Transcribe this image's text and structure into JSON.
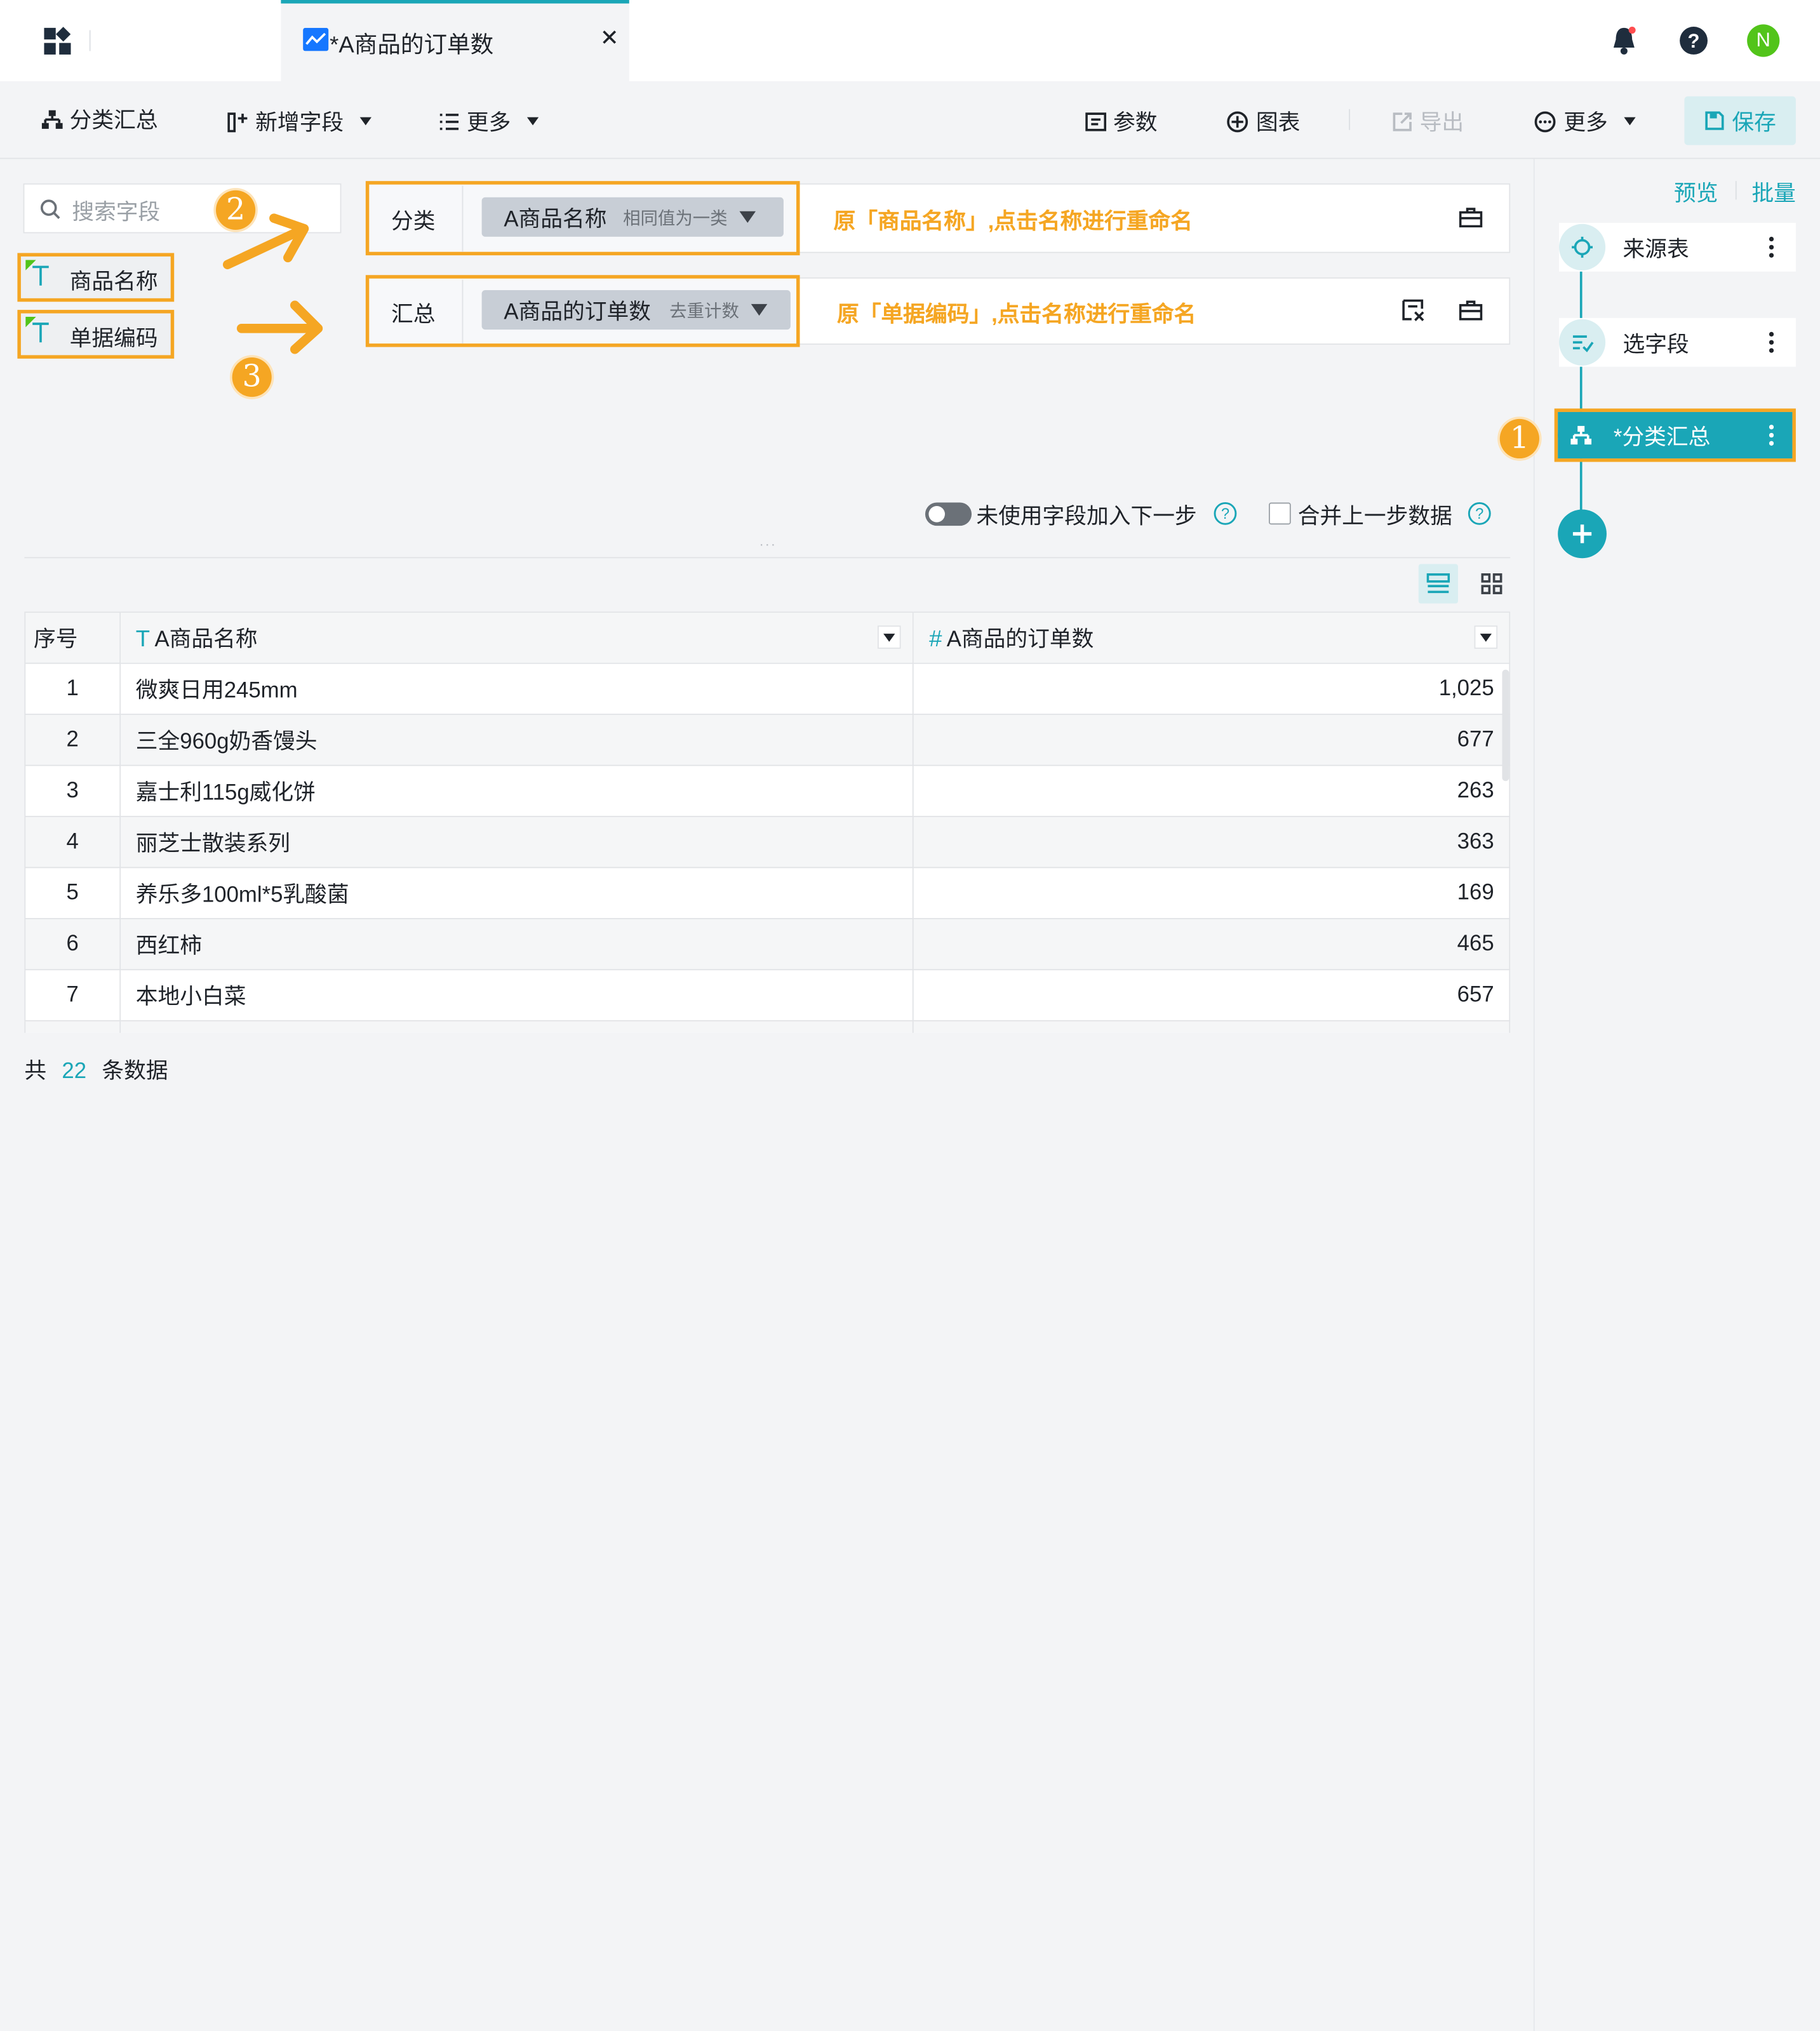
{
  "header": {
    "tab_title": "*A商品的订单数"
  },
  "toolbar": {
    "group_summary": "分类汇总",
    "add_field": "新增字段",
    "more_left": "更多",
    "params": "参数",
    "chart": "图表",
    "export": "导出",
    "more_right": "更多",
    "save": "保存"
  },
  "left": {
    "search_placeholder": "搜索字段",
    "fields": [
      "商品名称",
      "单据编码"
    ]
  },
  "config": {
    "category_label": "分类",
    "category_field": "A商品名称",
    "category_hint": "相同值为一类",
    "category_note": "原「商品名称」,点击名称进行重命名",
    "summary_label": "汇总",
    "summary_field": "A商品的订单数",
    "summary_hint": "去重计数",
    "summary_note": "原「单据编码」,点击名称进行重命名"
  },
  "badges": [
    "1",
    "2",
    "3"
  ],
  "options": {
    "unused_fields": "未使用字段加入下一步",
    "merge_prev": "合并上一步数据"
  },
  "table": {
    "headers": [
      "序号",
      "A商品名称",
      "A商品的订单数"
    ],
    "rows": [
      [
        "1",
        "微爽日用245mm",
        "1,025"
      ],
      [
        "2",
        "三全960g奶香馒头",
        "677"
      ],
      [
        "3",
        "嘉士利115g威化饼",
        "263"
      ],
      [
        "4",
        "丽芝士散装系列",
        "363"
      ],
      [
        "5",
        "养乐多100ml*5乳酸菌",
        "169"
      ],
      [
        "6",
        "西红柿",
        "465"
      ],
      [
        "7",
        "本地小白菜",
        "657"
      ]
    ]
  },
  "footer": {
    "prefix": "共",
    "count": "22",
    "suffix": "条数据"
  },
  "right": {
    "preview": "预览",
    "batch": "批量",
    "steps": [
      "来源表",
      "选字段",
      "*分类汇总"
    ]
  },
  "user": {
    "avatar_letter": "N"
  },
  "colors": {
    "accent": "#1aa6b7",
    "highlight": "#f5a623",
    "avatar": "#52c41a"
  }
}
